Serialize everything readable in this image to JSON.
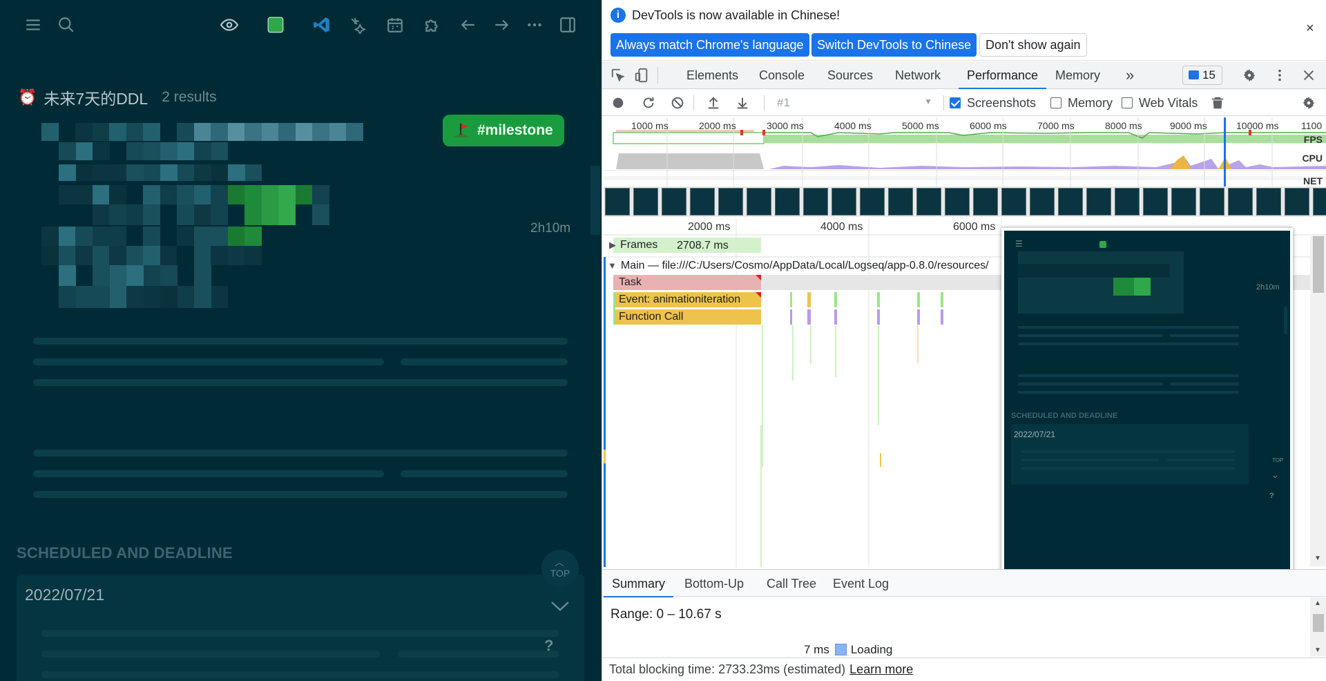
{
  "app": {
    "topbar": {
      "icons": [
        "menu-icon",
        "search-icon",
        "eye-icon",
        "green-square-icon",
        "vscode-icon",
        "sparkles-icon",
        "calendar-icon",
        "puzzle-icon",
        "arrow-left-icon",
        "arrow-right-icon",
        "more-icon",
        "sidebar-toggle-icon"
      ]
    },
    "query": {
      "emoji": "⏰",
      "title": "未来7天的DDL",
      "count": "2 results"
    },
    "tag": "#milestone",
    "duration": "2h10m",
    "scheduled": {
      "title": "SCHEDULED AND DEADLINE",
      "date": "2022/07/21"
    },
    "top_button": "TOP",
    "help": "?"
  },
  "devtools": {
    "infobar": {
      "message": "DevTools is now available in Chinese!",
      "buttons": [
        "Always match Chrome's language",
        "Switch DevTools to Chinese",
        "Don't show again"
      ],
      "close": "×"
    },
    "tabs": [
      "Elements",
      "Console",
      "Sources",
      "Network",
      "Performance",
      "Memory"
    ],
    "active_tab": "Performance",
    "more_tabs": "»",
    "issues_count": "15",
    "toolbar": {
      "profile": "#1",
      "checkboxes": [
        {
          "label": "Screenshots",
          "checked": true
        },
        {
          "label": "Memory",
          "checked": false
        },
        {
          "label": "Web Vitals",
          "checked": false
        }
      ]
    },
    "overview": {
      "ticks": [
        "1000 ms",
        "2000 ms",
        "3000 ms",
        "4000 ms",
        "5000 ms",
        "6000 ms",
        "7000 ms",
        "8000 ms",
        "9000 ms",
        "10000 ms",
        "1100"
      ],
      "labels": [
        "FPS",
        "CPU",
        "NET"
      ]
    },
    "timeline": {
      "ticks": [
        "2000 ms",
        "4000 ms",
        "6000 ms"
      ],
      "frames_label": "Frames",
      "frames_value": "2708.7 ms",
      "main_label": "Main — file:///C:/Users/Cosmo/AppData/Local/Logseq/app-0.8.0/resources/",
      "flames": [
        "Task",
        "Event: animationiteration",
        "Function Call"
      ]
    },
    "preview": {
      "duration": "2h10m",
      "section": "SCHEDULED AND DEADLINE",
      "date": "2022/07/21",
      "top": "TOP",
      "help": "?"
    },
    "bottom_tabs": [
      "Summary",
      "Bottom-Up",
      "Call Tree",
      "Event Log"
    ],
    "summary": {
      "range": "Range: 0 – 10.67 s",
      "loading_time": "7 ms",
      "loading_label": "Loading"
    },
    "footer": {
      "text": "Total blocking time: 2733.23ms (estimated)",
      "link": "Learn more"
    }
  }
}
